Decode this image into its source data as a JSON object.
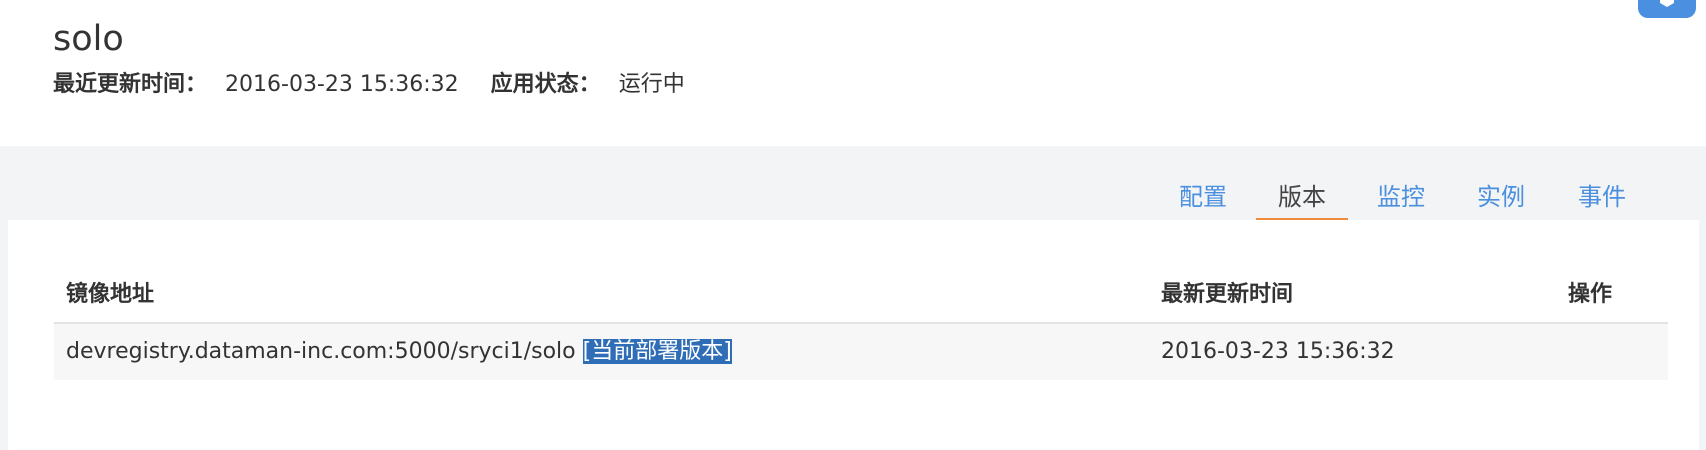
{
  "app": {
    "title": "solo",
    "updated_label": "最近更新时间：",
    "updated_value": "2016-03-23 15:36:32",
    "status_label": "应用状态：",
    "status_value": "运行中"
  },
  "tabs": [
    {
      "label": "配置",
      "active": false
    },
    {
      "label": "版本",
      "active": true
    },
    {
      "label": "监控",
      "active": false
    },
    {
      "label": "实例",
      "active": false
    },
    {
      "label": "事件",
      "active": false
    }
  ],
  "table": {
    "headers": [
      "镜像地址",
      "最新更新时间",
      "操作"
    ],
    "rows": [
      {
        "image": "devregistry.dataman-inc.com:5000/sryci1/solo",
        "tag": "[当前部署版本]",
        "updated": "2016-03-23 15:36:32",
        "action": ""
      }
    ]
  },
  "colors": {
    "link": "#4a8fe0",
    "tab_underline": "#f08a3c",
    "selection": "#2f6db6",
    "page_bg": "#f3f4f5"
  },
  "icons": {
    "corner": "cube-icon"
  }
}
